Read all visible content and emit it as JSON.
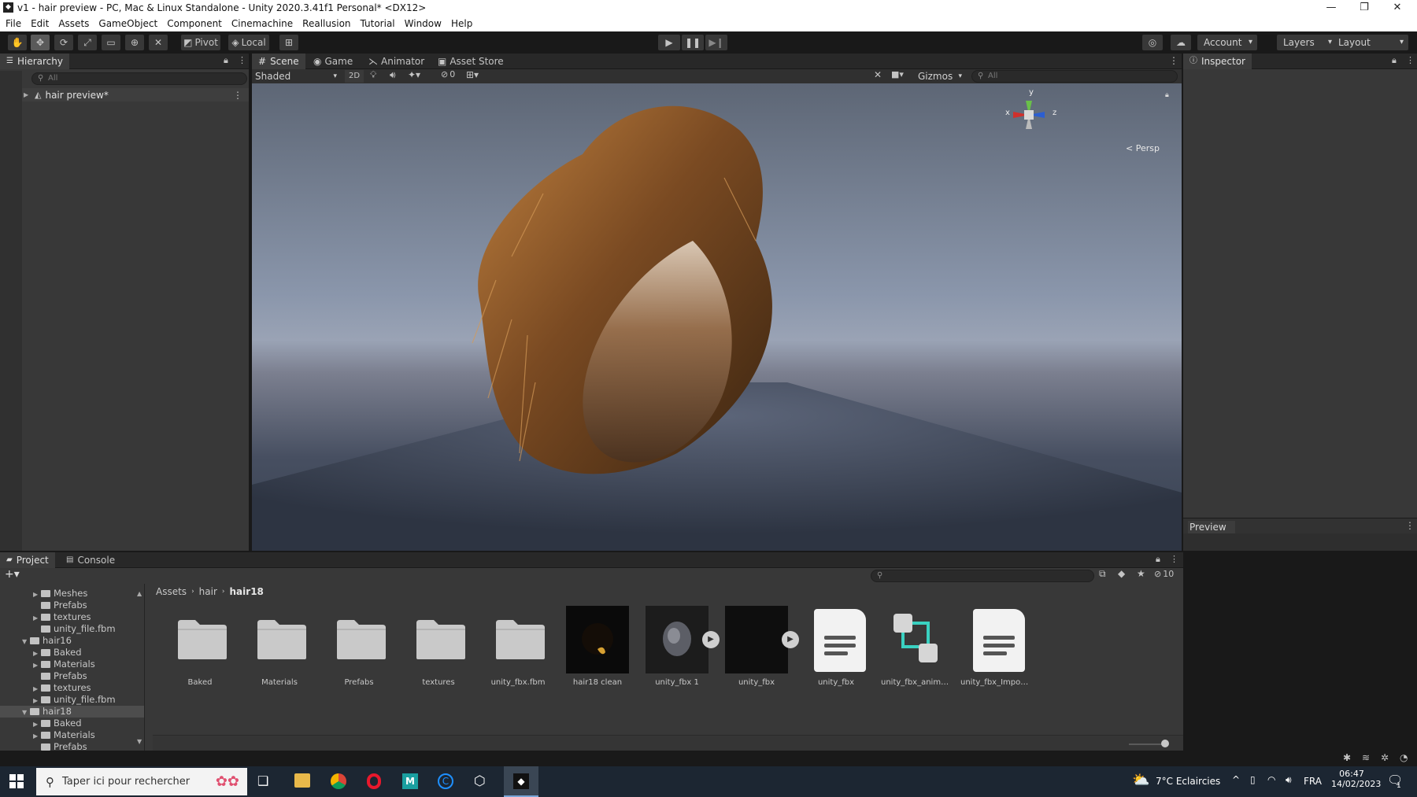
{
  "window": {
    "title": "v1 - hair preview - PC, Mac & Linux Standalone - Unity 2020.3.41f1 Personal* <DX12>"
  },
  "menu": [
    "File",
    "Edit",
    "Assets",
    "GameObject",
    "Component",
    "Cinemachine",
    "Reallusion",
    "Tutorial",
    "Window",
    "Help"
  ],
  "toolbar": {
    "pivot": "Pivot",
    "local": "Local",
    "account": "Account",
    "layers": "Layers",
    "layout": "Layout"
  },
  "hierarchy": {
    "tab": "Hierarchy",
    "search_placeholder": "All",
    "root_item": "hair preview*"
  },
  "scene": {
    "tabs": [
      "Scene",
      "Game",
      "Animator",
      "Asset Store"
    ],
    "shading_mode": "Shaded",
    "mode_2d": "2D",
    "hidden_count": "0",
    "gizmos": "Gizmos",
    "search_placeholder": "All",
    "axis_x": "x",
    "axis_y": "y",
    "axis_z": "z",
    "projection": "< Persp"
  },
  "inspector": {
    "tab": "Inspector",
    "preview": "Preview"
  },
  "project": {
    "tabs": [
      "Project",
      "Console"
    ],
    "hidden_count": "10",
    "breadcrumb": [
      "Assets",
      "hair",
      "hair18"
    ],
    "tree": [
      {
        "label": "Meshes",
        "level": 2,
        "expanded": false
      },
      {
        "label": "Prefabs",
        "level": 2,
        "expanded": null
      },
      {
        "label": "textures",
        "level": 2,
        "expanded": false
      },
      {
        "label": "unity_file.fbm",
        "level": 2,
        "expanded": null
      },
      {
        "label": "hair16",
        "level": 1,
        "expanded": true
      },
      {
        "label": "Baked",
        "level": 2,
        "expanded": false
      },
      {
        "label": "Materials",
        "level": 2,
        "expanded": false
      },
      {
        "label": "Prefabs",
        "level": 2,
        "expanded": null
      },
      {
        "label": "textures",
        "level": 2,
        "expanded": false
      },
      {
        "label": "unity_file.fbm",
        "level": 2,
        "expanded": false
      },
      {
        "label": "hair18",
        "level": 1,
        "expanded": true,
        "selected": true
      },
      {
        "label": "Baked",
        "level": 2,
        "expanded": false
      },
      {
        "label": "Materials",
        "level": 2,
        "expanded": false
      },
      {
        "label": "Prefabs",
        "level": 2,
        "expanded": null
      }
    ],
    "assets": [
      {
        "label": "Baked",
        "kind": "folder"
      },
      {
        "label": "Materials",
        "kind": "folder"
      },
      {
        "label": "Prefabs",
        "kind": "folder"
      },
      {
        "label": "textures",
        "kind": "folder"
      },
      {
        "label": "unity_fbx.fbm",
        "kind": "folder"
      },
      {
        "label": "hair18 clean",
        "kind": "material"
      },
      {
        "label": "unity_fbx 1",
        "kind": "model"
      },
      {
        "label": "unity_fbx",
        "kind": "model-dark"
      },
      {
        "label": "unity_fbx",
        "kind": "doc"
      },
      {
        "label": "unity_fbx_animat...",
        "kind": "animator"
      },
      {
        "label": "unity_fbx_Importi...",
        "kind": "doc"
      }
    ]
  },
  "taskbar": {
    "search_placeholder": "Taper ici pour rechercher",
    "weather": "7°C  Eclaircies",
    "language": "FRA",
    "time": "06:47",
    "date": "14/02/2023",
    "notifications": "1"
  },
  "colors": {
    "editor_bg": "#383838",
    "dark_bg": "#191919",
    "taskbar_bg": "#1c2632",
    "selection": "#4d4d4d"
  }
}
